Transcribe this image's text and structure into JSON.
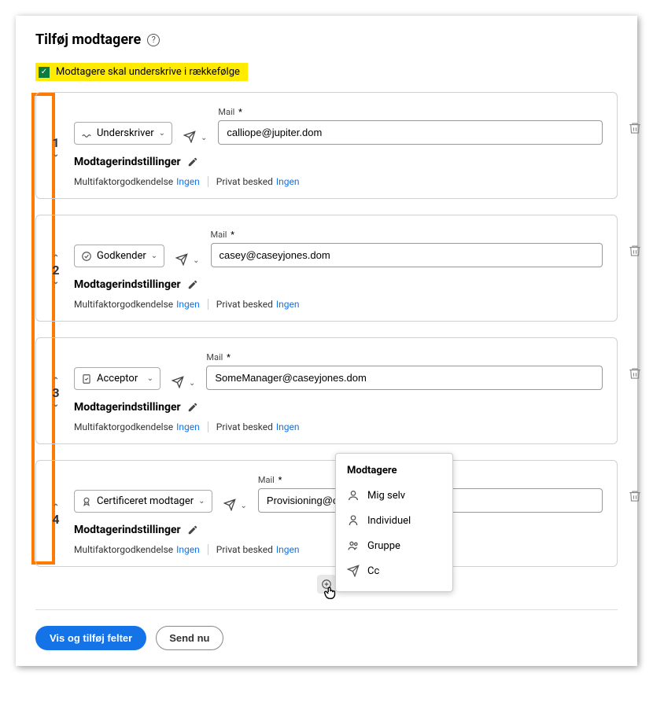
{
  "title": "Tilføj modtagere",
  "checkbox_label": "Modtagere skal underskrive i rækkefølge",
  "mail_label": "Mail",
  "settings_title": "Modtagerindstillinger",
  "mfa_label": "Multifaktorgodkendelse",
  "none_value": "Ingen",
  "private_msg_label": "Privat besked",
  "recipients": [
    {
      "order": "1",
      "role": "Underskriver",
      "email": "calliope@jupiter.dom"
    },
    {
      "order": "2",
      "role": "Godkender",
      "email": "casey@caseyjones.dom"
    },
    {
      "order": "3",
      "role": "Acceptor",
      "email": "SomeManager@caseyjones.dom"
    },
    {
      "order": "4",
      "role": "Certificeret modtager",
      "email": "Provisioning@caseyjones.dom"
    }
  ],
  "popup": {
    "title": "Modtagere",
    "items": [
      "Mig selv",
      "Individuel",
      "Gruppe",
      "Cc"
    ]
  },
  "footer": {
    "primary": "Vis og tilføj felter",
    "secondary": "Send nu"
  }
}
